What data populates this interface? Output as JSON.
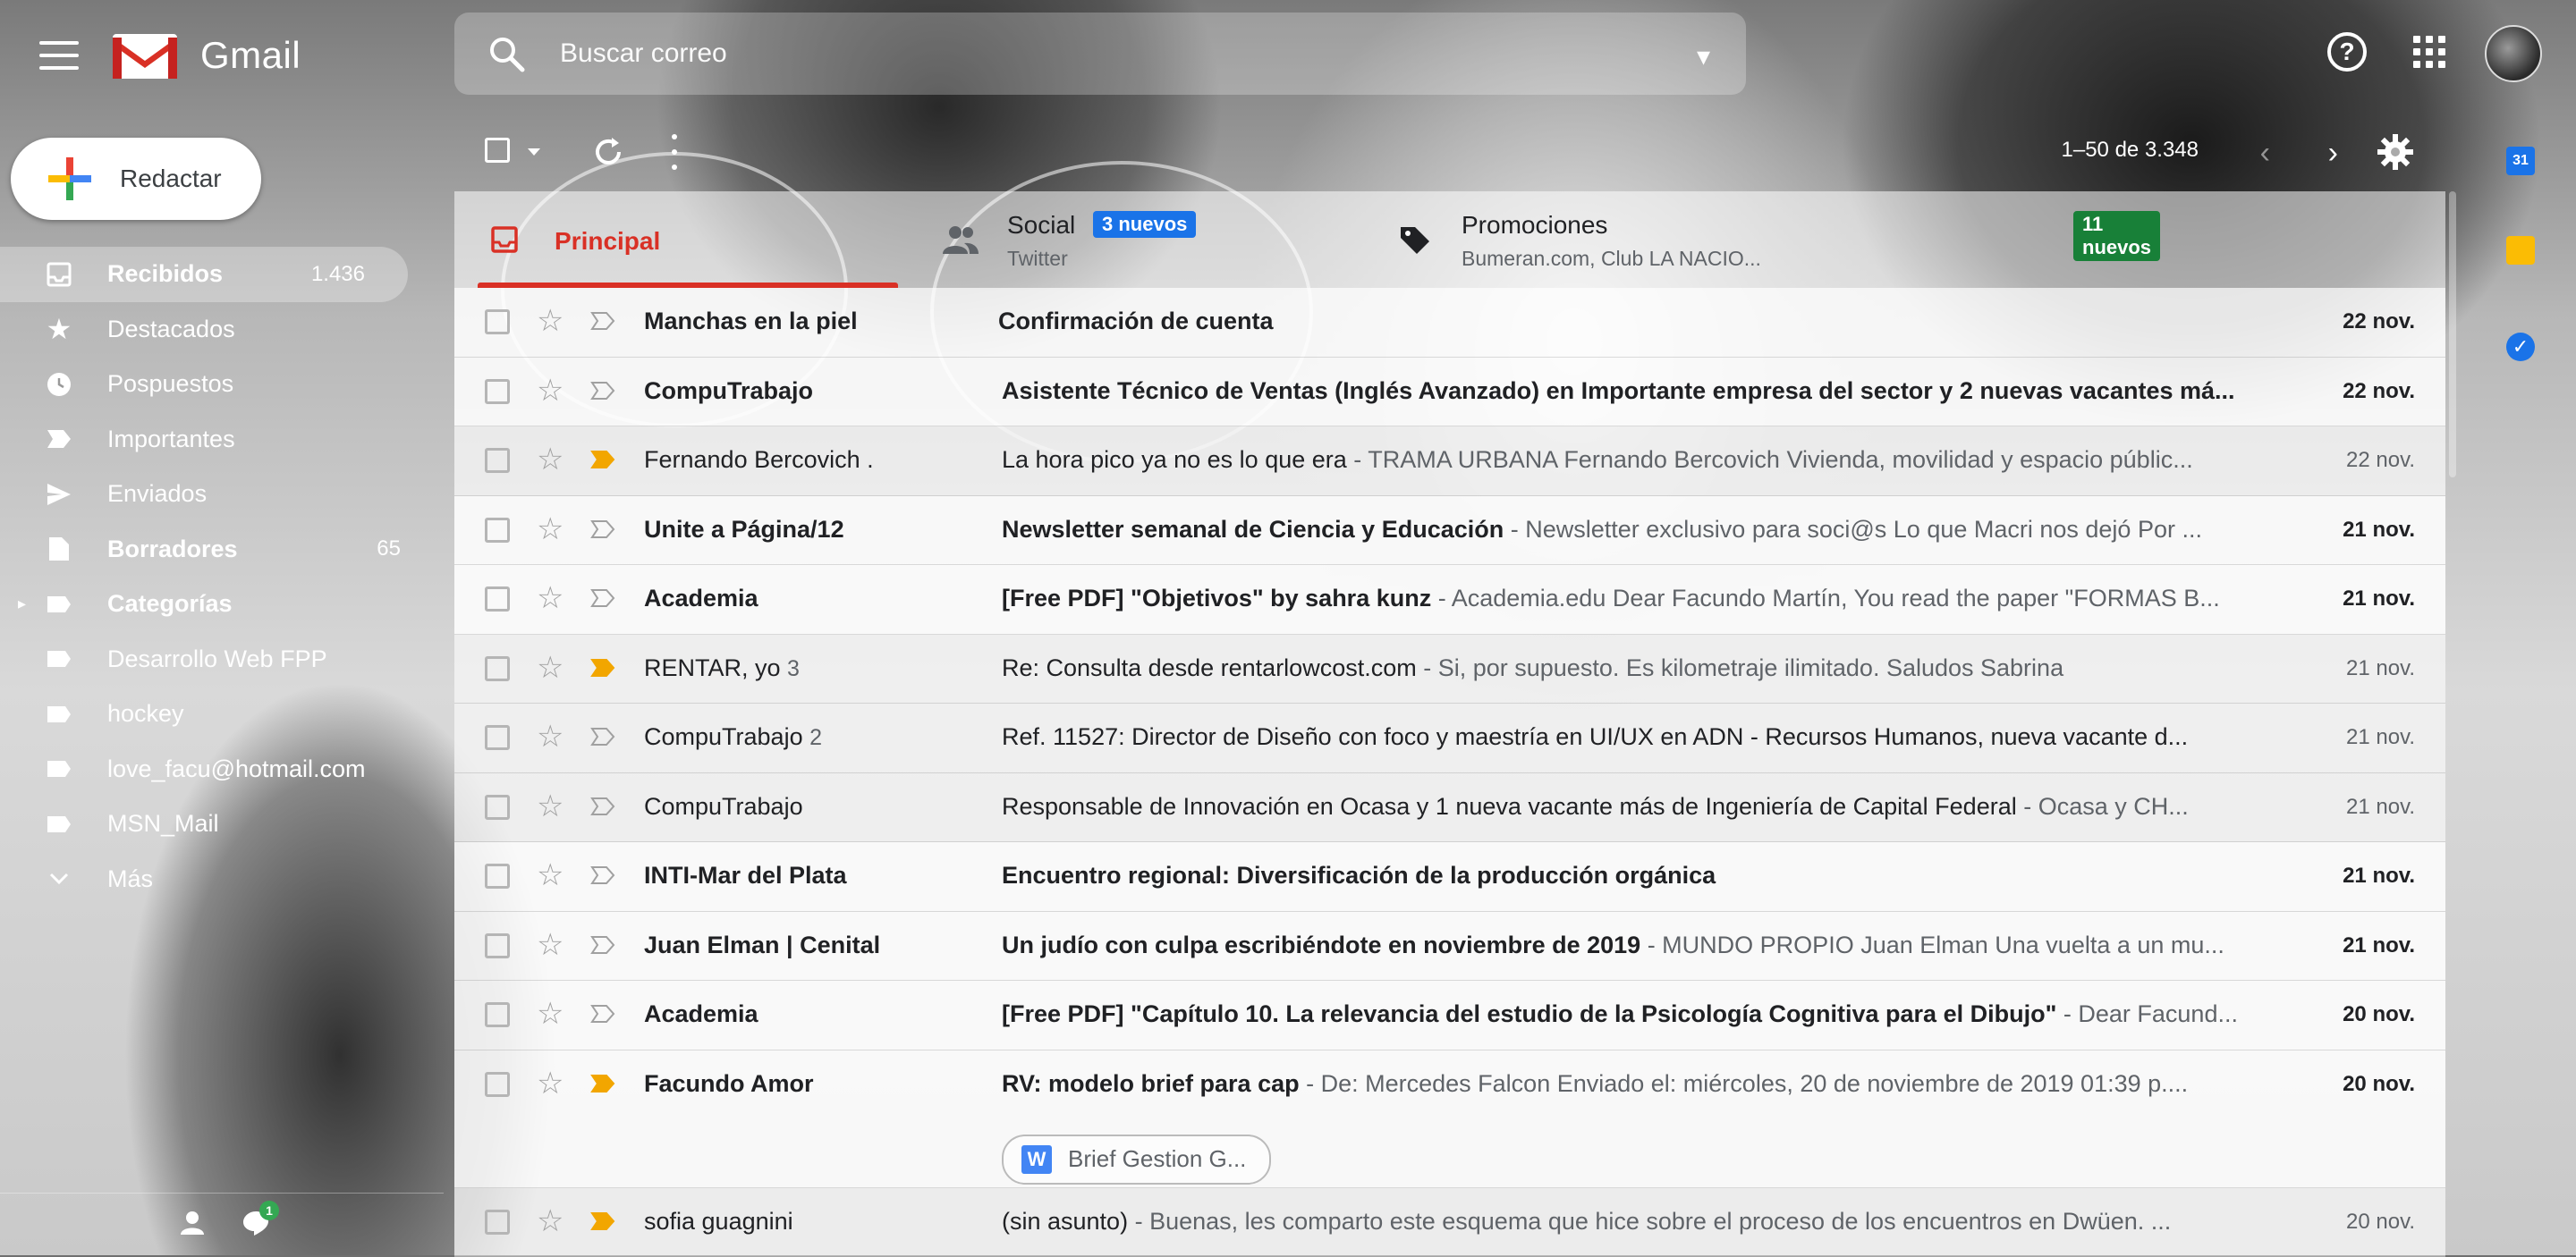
{
  "app": {
    "name": "Gmail"
  },
  "search": {
    "placeholder": "Buscar correo"
  },
  "compose": {
    "label": "Redactar"
  },
  "sidebar": {
    "items": [
      {
        "label": "Recibidos",
        "count": "1.436",
        "icon": "inbox-icon",
        "active": true,
        "bold": true
      },
      {
        "label": "Destacados",
        "count": "",
        "icon": "star-icon"
      },
      {
        "label": "Pospuestos",
        "count": "",
        "icon": "clock-icon"
      },
      {
        "label": "Importantes",
        "count": "",
        "icon": "important-icon"
      },
      {
        "label": "Enviados",
        "count": "",
        "icon": "send-icon"
      },
      {
        "label": "Borradores",
        "count": "65",
        "icon": "draft-icon",
        "bold": true
      },
      {
        "label": "Categorías",
        "count": "",
        "icon": "label-icon",
        "bold": true,
        "expandable": true
      },
      {
        "label": "Desarrollo Web FPP",
        "count": "",
        "icon": "label-icon"
      },
      {
        "label": "hockey",
        "count": "",
        "icon": "label-icon"
      },
      {
        "label": "love_facu@hotmail.com",
        "count": "",
        "icon": "label-icon"
      },
      {
        "label": "MSN_Mail",
        "count": "",
        "icon": "label-icon"
      },
      {
        "label": "Más",
        "count": "",
        "icon": "chevron-down-icon"
      }
    ],
    "hangouts_badge": "1"
  },
  "toolbar": {
    "range": "1–50 de 3.348"
  },
  "tabs": [
    {
      "label": "Principal",
      "icon": "inbox-icon",
      "active": true
    },
    {
      "label": "Social",
      "badge": "3 nuevos",
      "badge_color": "#1a73e8",
      "sub": "Twitter",
      "icon": "people-icon"
    },
    {
      "label": "Promociones",
      "badge": "11 nuevos",
      "badge_color": "#188038",
      "sub": "Bumeran.com, Club LA NACIO...",
      "icon": "tag-icon"
    }
  ],
  "emails": [
    {
      "sender": "Manchas en la piel",
      "count": "",
      "subject": "Confirmación de cuenta",
      "snippet": "",
      "date": "22 nov.",
      "unread": true,
      "important": false
    },
    {
      "sender": "CompuTrabajo",
      "count": "",
      "subject": "Asistente Técnico de Ventas (Inglés Avanzado) en Importante empresa del sector y 2 nuevas vacantes má...",
      "snippet": "",
      "date": "22 nov.",
      "unread": true,
      "important": false
    },
    {
      "sender": "Fernando Bercovich .",
      "count": "",
      "subject": "La hora pico ya no es lo que era",
      "snippet": " - TRAMA URBANA Fernando Bercovich Vivienda, movilidad y espacio públic...",
      "date": "22 nov.",
      "unread": false,
      "important": true
    },
    {
      "sender": "Unite a Página/12",
      "count": "",
      "subject": "Newsletter semanal de Ciencia y Educación",
      "snippet": " - Newsletter exclusivo para soci@s Lo que Macri nos dejó Por ...",
      "date": "21 nov.",
      "unread": true,
      "important": false
    },
    {
      "sender": "Academia",
      "count": "",
      "subject": "[Free PDF] \"Objetivos\" by sahra kunz",
      "snippet": " - Academia.edu Dear Facundo Martín, You read the paper \"FORMAS B...",
      "date": "21 nov.",
      "unread": true,
      "important": false
    },
    {
      "sender": "RENTAR, yo",
      "count": "3",
      "subject": "Re: Consulta desde rentarlowcost.com",
      "snippet": " - Si, por supuesto. Es kilometraje ilimitado. Saludos Sabrina",
      "date": "21 nov.",
      "unread": false,
      "important": true
    },
    {
      "sender": "CompuTrabajo",
      "count": "2",
      "subject": "Ref. 11527: Director de Diseño con foco y maestría en UI/UX en ADN - Recursos Humanos, nueva vacante d...",
      "snippet": "",
      "date": "21 nov.",
      "unread": false,
      "important": false
    },
    {
      "sender": "CompuTrabajo",
      "count": "",
      "subject": "Responsable de Innovación en Ocasa y 1 nueva vacante más de Ingeniería de Capital Federal",
      "snippet": " - Ocasa y CH...",
      "date": "21 nov.",
      "unread": false,
      "important": false
    },
    {
      "sender": "INTI-Mar del Plata",
      "count": "",
      "subject": "Encuentro regional: Diversificación de la producción orgánica",
      "snippet": "",
      "date": "21 nov.",
      "unread": true,
      "important": false
    },
    {
      "sender": "Juan Elman | Cenital",
      "count": "",
      "subject": "Un judío con culpa escribiéndote en noviembre de 2019",
      "snippet": " - MUNDO PROPIO Juan Elman Una vuelta a un mu...",
      "date": "21 nov.",
      "unread": true,
      "important": false
    },
    {
      "sender": "Academia",
      "count": "",
      "subject": "[Free PDF] \"Capítulo 10. La relevancia del estudio de la Psicología Cognitiva para el Dibujo\"",
      "snippet": " - Dear Facund...",
      "date": "20 nov.",
      "unread": true,
      "important": false
    },
    {
      "sender": "Facundo Amor",
      "count": "",
      "subject": "RV: modelo brief para cap",
      "snippet": " - De: Mercedes Falcon Enviado el: miércoles, 20 de noviembre de 2019 01:39 p....",
      "date": "20 nov.",
      "unread": true,
      "important": true,
      "attachment": "Brief Gestion G..."
    },
    {
      "sender": "sofia guagnini",
      "count": "",
      "subject": "(sin asunto)",
      "snippet": " - Buenas, les comparto este esquema que hice sobre el proceso de los encuentros en Dwüen. ...",
      "date": "20 nov.",
      "unread": false,
      "important": true
    }
  ]
}
